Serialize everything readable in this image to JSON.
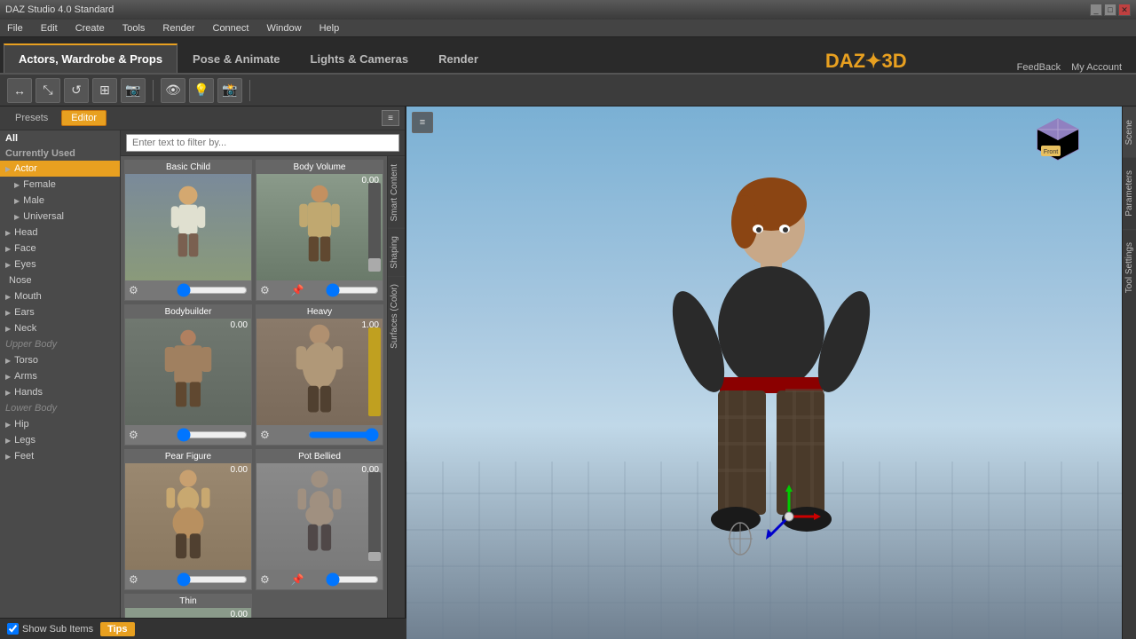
{
  "app": {
    "title": "DAZ Studio 4.0 Standard",
    "winbtns": [
      "_",
      "□",
      "✕"
    ]
  },
  "menubar": {
    "items": [
      "File",
      "Edit",
      "Create",
      "Tools",
      "Render",
      "Connect",
      "Window",
      "Help"
    ]
  },
  "navtabs": {
    "items": [
      {
        "label": "Actors, Wardrobe & Props",
        "active": true
      },
      {
        "label": "Pose & Animate",
        "active": false
      },
      {
        "label": "Lights & Cameras",
        "active": false
      },
      {
        "label": "Render",
        "active": false
      }
    ],
    "right": [
      {
        "label": "FeedBack"
      },
      {
        "label": "My Account"
      }
    ]
  },
  "toolbar": {
    "buttons": [
      "⊕",
      "⊡",
      "⊞",
      "⊟",
      "⊠",
      "|",
      "⊛",
      "⊜",
      "⊝",
      "⊙"
    ]
  },
  "panel": {
    "tabs": [
      {
        "label": "Presets",
        "active": false
      },
      {
        "label": "Editor",
        "active": true
      }
    ],
    "filter_placeholder": "Enter text to filter by...",
    "categories": [
      {
        "label": "All",
        "type": "all"
      },
      {
        "label": "Currently Used",
        "type": "section"
      },
      {
        "label": "Actor",
        "type": "selected"
      },
      {
        "label": "Female",
        "type": "child",
        "indent": 1
      },
      {
        "label": "Male",
        "type": "child",
        "indent": 1
      },
      {
        "label": "Universal",
        "type": "child",
        "indent": 1
      },
      {
        "label": "Head",
        "type": "child",
        "indent": 0
      },
      {
        "label": "Face",
        "type": "child",
        "indent": 0
      },
      {
        "label": "Eyes",
        "type": "child",
        "indent": 0
      },
      {
        "label": "Nose",
        "type": "child",
        "indent": 0
      },
      {
        "label": "Mouth",
        "type": "child",
        "indent": 0
      },
      {
        "label": "Ears",
        "type": "child",
        "indent": 0
      },
      {
        "label": "Neck",
        "type": "child",
        "indent": 0
      },
      {
        "label": "Upper Body",
        "type": "disabled"
      },
      {
        "label": "Torso",
        "type": "child",
        "indent": 0
      },
      {
        "label": "Arms",
        "type": "child",
        "indent": 0
      },
      {
        "label": "Hands",
        "type": "child",
        "indent": 0
      },
      {
        "label": "Lower Body",
        "type": "disabled"
      },
      {
        "label": "Hip",
        "type": "child",
        "indent": 0
      },
      {
        "label": "Legs",
        "type": "child",
        "indent": 0
      },
      {
        "label": "Feet",
        "type": "child",
        "indent": 0
      }
    ],
    "content_cards": [
      {
        "title": "Basic Child",
        "value": "",
        "bg": "#8a9a8a"
      },
      {
        "title": "Body Volume",
        "value": "0.00",
        "bg": "#9aaa9a"
      },
      {
        "title": "Bodybuilder",
        "value": "0.00",
        "bg": "#8a9a8a"
      },
      {
        "title": "Heavy",
        "value": "1.00",
        "bg": "#9a8a7a"
      },
      {
        "title": "Pear Figure",
        "value": "0.00",
        "bg": "#b09070"
      },
      {
        "title": "Pot Bellied",
        "value": "0.00",
        "bg": "#9a9a9a"
      },
      {
        "title": "Thin",
        "value": "0.00",
        "bg": "#8a9a8a"
      }
    ],
    "right_tabs": [
      "Smart Content",
      "Shaping",
      "Surfaces (Color)"
    ],
    "show_sub_items": "Show Sub Items",
    "tips_label": "Tips"
  },
  "viewport": {
    "right_panels": [
      "Scene",
      "Parameters",
      "Tool Settings"
    ],
    "scene_cube_label": "Front"
  },
  "daz": {
    "logo": "DAZ",
    "logo2": "3D"
  }
}
